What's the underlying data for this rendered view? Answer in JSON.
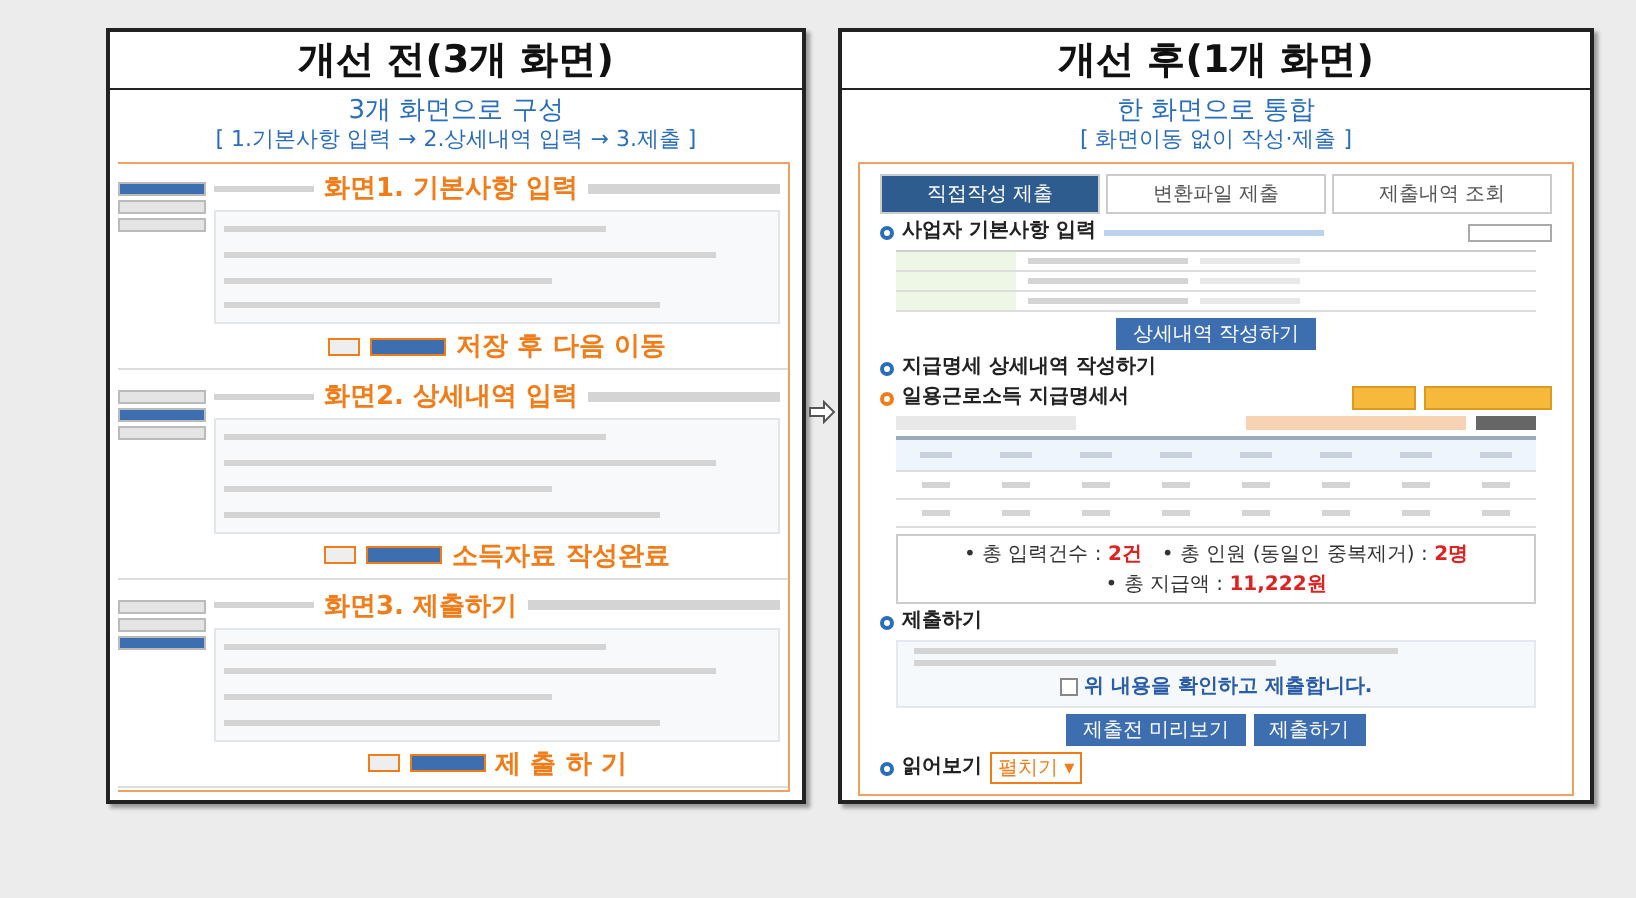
{
  "before": {
    "title": "개선 전(3개 화면)",
    "subtitle": "3개 화면으로 구성",
    "steps": "[ 1.기본사항 입력 → 2.상세내역 입력 → 3.제출 ]",
    "screens": [
      {
        "label": "화면1. 기본사항 입력",
        "action": "저장 후 다음 이동"
      },
      {
        "label": "화면2. 상세내역 입력",
        "action": "소득자료 작성완료"
      },
      {
        "label": "화면3. 제출하기",
        "action": "제 출 하 기"
      }
    ]
  },
  "after": {
    "title": "개선 후(1개 화면)",
    "subtitle": "한 화면으로 통합",
    "steps": "[ 화면이동 없이 작성·제출 ]",
    "tabs": [
      {
        "label": "직접작성 제출",
        "selected": true
      },
      {
        "label": "변환파일 제출",
        "selected": false
      },
      {
        "label": "제출내역 조회",
        "selected": false
      }
    ],
    "basic_heading": "사업자 기본사항 입력",
    "detail_button": "상세내역 작성하기",
    "detail_heading": "지급명세 상세내역 작성하기",
    "detail_subheading": "일용근로소득 지급명세서",
    "summary": [
      {
        "label": "• 총 입력건수 : ",
        "value": "2건"
      },
      {
        "label": "• 총 인원 (동일인 중복제거) : ",
        "value": "2명"
      },
      {
        "label": "• 총 지급액 : ",
        "value": "11,222원"
      }
    ],
    "submit_heading": "제출하기",
    "confirm": {
      "label": "위 내용을 확인하고 제출합니다.",
      "checked": false
    },
    "buttons": [
      "제출전 미리보기",
      "제출하기"
    ],
    "read_heading": "읽어보기",
    "read_toggle": "펼치기 ▾"
  }
}
